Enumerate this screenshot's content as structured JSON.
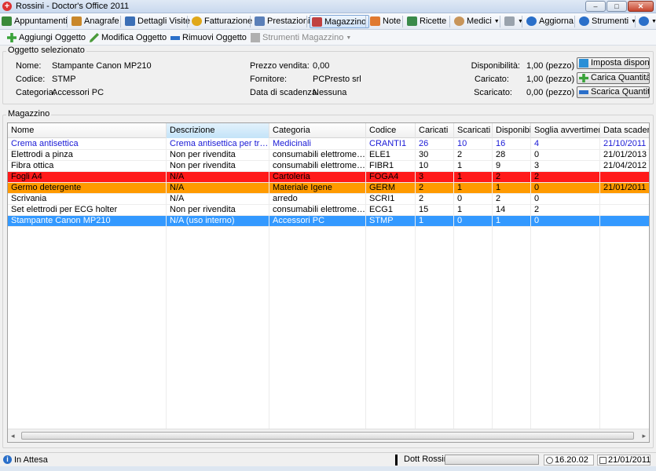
{
  "window": {
    "title": "Rossini - Doctor's Office 2011",
    "min_glyph": "–",
    "max_glyph": "□",
    "close_glyph": "✕"
  },
  "menubar": {
    "items": [
      {
        "label": "Appuntamenti",
        "icon": "calendar-icon",
        "color": "#3a8a3a"
      },
      {
        "label": "Anagrafe",
        "icon": "people-icon",
        "color": "#c9872a"
      },
      {
        "label": "Dettagli Visite",
        "icon": "clipboard-icon",
        "color": "#3b6fb6"
      },
      {
        "label": "Fatturazione",
        "icon": "coin-icon",
        "color": "#e0a81a"
      },
      {
        "label": "Prestazioni",
        "icon": "list-icon",
        "color": "#5a7fb8"
      },
      {
        "label": "Magazzino",
        "icon": "warehouse-icon",
        "color": "#c04040"
      },
      {
        "label": "Note",
        "icon": "note-icon",
        "color": "#e07a30"
      },
      {
        "label": "Ricette",
        "icon": "prescription-icon",
        "color": "#3a8a4a"
      },
      {
        "label": "Medici",
        "icon": "doctor-icon",
        "color": "#c8955a"
      },
      {
        "label": "",
        "icon": "printer-icon",
        "color": "#9aa3ad"
      },
      {
        "label": "Aggiorna",
        "icon": "refresh-icon",
        "color": "#2a6fc9"
      },
      {
        "label": "Strumenti",
        "icon": "tools-icon",
        "color": "#2a6fc9"
      },
      {
        "label": "",
        "icon": "help-icon",
        "color": "#2a6fc9"
      }
    ]
  },
  "toolbar": {
    "add": "Aggiungi Oggetto",
    "edit": "Modifica Oggetto",
    "remove": "Rimuovi Oggetto",
    "tools": "Strumenti Magazzino"
  },
  "selected": {
    "group_title": "Oggetto selezionato",
    "name_label": "Nome:",
    "name_value": "Stampante Canon MP210",
    "code_label": "Codice:",
    "code_value": "STMP",
    "category_label": "Categoria:",
    "category_value": "Accessori PC",
    "price_label": "Prezzo vendita:",
    "price_value": "0,00",
    "supplier_label": "Fornitore:",
    "supplier_value": "PCPresto srl",
    "expiry_label": "Data di scadenza:",
    "expiry_value": "Nessuna",
    "avail_label": "Disponibilità:",
    "avail_value": "1,00 (pezzo)",
    "loaded_label": "Caricato:",
    "loaded_value": "1,00 (pezzo)",
    "unloaded_label": "Scaricato:",
    "unloaded_value": "0,00 (pezzo)",
    "btn_set": "Imposta disponibilità",
    "btn_load": "Carica Quantità",
    "btn_unload": "Scarica Quantità"
  },
  "warehouse": {
    "group_title": "Magazzino",
    "columns": [
      "Nome",
      "Descrizione",
      "Categoria",
      "Codice",
      "Caricati",
      "Scaricati",
      "Disponibili",
      "Soglia avvertimento",
      "Data scadenza"
    ],
    "rows": [
      {
        "cells": [
          "Crema antisettica",
          "Crema antisettica per trattamenti",
          "Medicinali",
          "CRANTI1",
          "26",
          "10",
          "16",
          "4",
          "21/10/2011"
        ],
        "style": "blue-text"
      },
      {
        "cells": [
          "Elettrodi a pinza",
          "Non per rivendita",
          "consumabili elettromedicali",
          "ELE1",
          "30",
          "2",
          "28",
          "0",
          "21/01/2013"
        ],
        "style": "normal"
      },
      {
        "cells": [
          "Fibra ottica",
          "Non per rivendita",
          "consumabili elettromedicali",
          "FIBR1",
          "10",
          "1",
          "9",
          "3",
          "21/04/2012"
        ],
        "style": "normal"
      },
      {
        "cells": [
          "Fogli A4",
          "N/A",
          "Cartoleria",
          "FOGA4",
          "3",
          "1",
          "2",
          "2",
          ""
        ],
        "style": "red"
      },
      {
        "cells": [
          "Germo detergente",
          "N/A",
          "Materiale Igene",
          "GERM",
          "2",
          "1",
          "1",
          "0",
          "21/01/2011"
        ],
        "style": "orange"
      },
      {
        "cells": [
          "Scrivania",
          "N/A",
          "arredo",
          "SCRI1",
          "2",
          "0",
          "2",
          "0",
          ""
        ],
        "style": "normal"
      },
      {
        "cells": [
          "Set elettrodi per ECG holter",
          "Non per rivendita",
          "consumabili elettromedicali",
          "ECG1",
          "15",
          "1",
          "14",
          "2",
          ""
        ],
        "style": "normal"
      },
      {
        "cells": [
          "Stampante Canon MP210",
          "N/A (uso interno)",
          "Accessori PC",
          "STMP",
          "1",
          "0",
          "1",
          "0",
          ""
        ],
        "style": "selected"
      }
    ],
    "scroll_left": "◂",
    "scroll_right": "▸"
  },
  "colors": {
    "blue_text": "#1a1ad6",
    "red_row": "#ff1a1a",
    "orange_row": "#ff9a00",
    "selected_row": "#3399ff"
  },
  "statusbar": {
    "status": "In Attesa",
    "user": "Dott Rossini",
    "time": "16.20.02",
    "date": "21/01/2011"
  }
}
